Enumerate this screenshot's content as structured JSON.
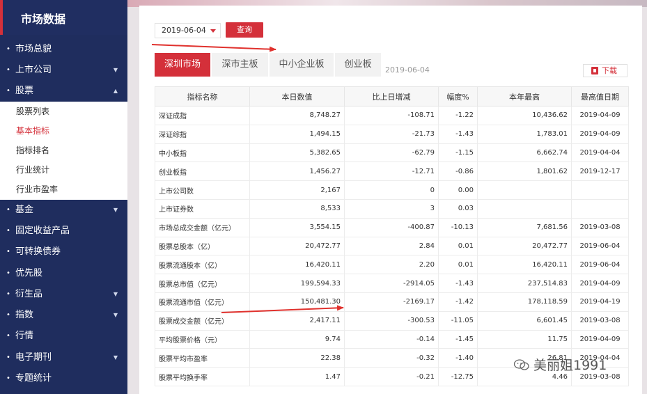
{
  "sidebar": {
    "title": "市场数据",
    "items": [
      {
        "label": "市场总貌",
        "chevron": ""
      },
      {
        "label": "上市公司",
        "chevron": "down"
      },
      {
        "label": "股票",
        "chevron": "up"
      },
      {
        "label": "基金",
        "chevron": "down"
      },
      {
        "label": "固定收益产品",
        "chevron": ""
      },
      {
        "label": "可转换债券",
        "chevron": ""
      },
      {
        "label": "优先股",
        "chevron": ""
      },
      {
        "label": "衍生品",
        "chevron": "down"
      },
      {
        "label": "指数",
        "chevron": "down"
      },
      {
        "label": "行情",
        "chevron": ""
      },
      {
        "label": "电子期刊",
        "chevron": "down"
      },
      {
        "label": "专题统计",
        "chevron": ""
      }
    ],
    "submenu": [
      "股票列表",
      "基本指标",
      "指标排名",
      "行业统计",
      "行业市盈率"
    ],
    "active_submenu": "基本指标"
  },
  "filter": {
    "date": "2019-06-04",
    "query_label": "查询"
  },
  "tabs": [
    "深圳市场",
    "深市主板",
    "中小企业板",
    "创业板"
  ],
  "active_tab": "深圳市场",
  "tab_date": "2019-06-04",
  "download_label": "下载",
  "table": {
    "headers": [
      "指标名称",
      "本日数值",
      "比上日增减",
      "幅度%",
      "本年最高",
      "最高值日期"
    ],
    "rows": [
      [
        "深证成指",
        "8,748.27",
        "-108.71",
        "-1.22",
        "10,436.62",
        "2019-04-09"
      ],
      [
        "深证综指",
        "1,494.15",
        "-21.73",
        "-1.43",
        "1,783.01",
        "2019-04-09"
      ],
      [
        "中小板指",
        "5,382.65",
        "-62.79",
        "-1.15",
        "6,662.74",
        "2019-04-04"
      ],
      [
        "创业板指",
        "1,456.27",
        "-12.71",
        "-0.86",
        "1,801.62",
        "2019-12-17"
      ],
      [
        "上市公司数",
        "2,167",
        "0",
        "0.00",
        "",
        ""
      ],
      [
        "上市证券数",
        "8,533",
        "3",
        "0.03",
        "",
        ""
      ],
      [
        "市场总成交金额（亿元）",
        "3,554.15",
        "-400.87",
        "-10.13",
        "7,681.56",
        "2019-03-08"
      ],
      [
        "股票总股本（亿）",
        "20,472.77",
        "2.84",
        "0.01",
        "20,472.77",
        "2019-06-04"
      ],
      [
        "股票流通股本（亿）",
        "16,420.11",
        "2.20",
        "0.01",
        "16,420.11",
        "2019-06-04"
      ],
      [
        "股票总市值（亿元）",
        "199,594.33",
        "-2914.05",
        "-1.43",
        "237,514.83",
        "2019-04-09"
      ],
      [
        "股票流通市值（亿元）",
        "150,481.30",
        "-2169.17",
        "-1.42",
        "178,118.59",
        "2019-04-19"
      ],
      [
        "股票成交金额（亿元）",
        "2,417.11",
        "-300.53",
        "-11.05",
        "6,601.45",
        "2019-03-08"
      ],
      [
        "平均股票价格（元）",
        "9.74",
        "-0.14",
        "-1.45",
        "11.75",
        "2019-04-09"
      ],
      [
        "股票平均市盈率",
        "22.38",
        "-0.32",
        "-1.40",
        "26.81",
        "2019-04-04"
      ],
      [
        "股票平均换手率",
        "1.47",
        "-0.21",
        "-12.75",
        "4.46",
        "2019-03-08"
      ]
    ]
  },
  "watermark": "美丽姐1991",
  "colors": {
    "sidebar": "#1f2d5e",
    "accent": "#d4303a",
    "arrow": "#e0312d"
  }
}
